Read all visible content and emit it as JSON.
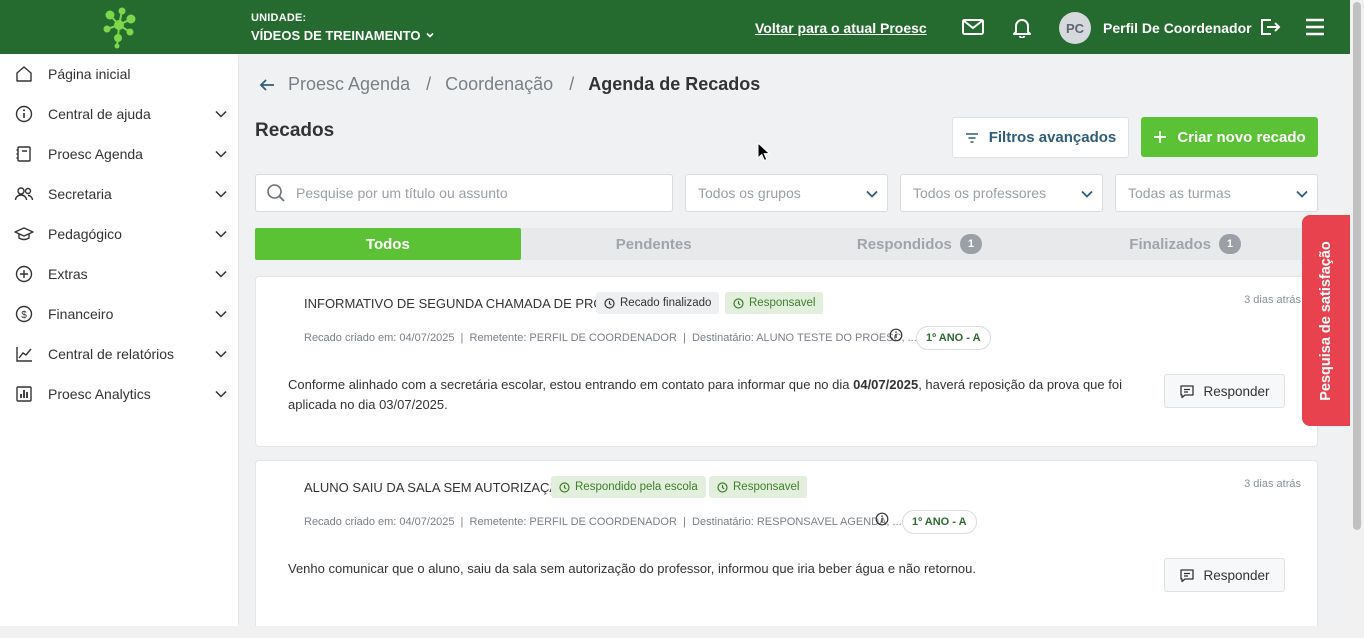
{
  "colors": {
    "brand_green": "#256a2f",
    "accent_green": "#5bc236",
    "survey_red": "#e8424f"
  },
  "header": {
    "unit_label": "UNIDADE:",
    "unit_value": "VÍDEOS DE TREINAMENTO",
    "back_link": "Voltar para o atual Proesc",
    "avatar_initials": "PC",
    "profile_name": "Perfil De Coordenador",
    "icons": [
      "logo-icon",
      "chevron-down-icon",
      "mail-icon",
      "bell-icon",
      "logout-icon",
      "menu-icon"
    ]
  },
  "sidebar": {
    "items": [
      {
        "label": "Página inicial",
        "icon": "home-icon"
      },
      {
        "label": "Central de ajuda",
        "icon": "info-icon"
      },
      {
        "label": "Proesc Agenda",
        "icon": "agenda-icon"
      },
      {
        "label": "Secretaria",
        "icon": "users-icon"
      },
      {
        "label": "Pedagógico",
        "icon": "graduation-cap-icon"
      },
      {
        "label": "Extras",
        "icon": "plus-circle-icon"
      },
      {
        "label": "Financeiro",
        "icon": "dollar-icon"
      },
      {
        "label": "Central de relatórios",
        "icon": "line-chart-icon"
      },
      {
        "label": "Proesc Analytics",
        "icon": "bar-chart-icon"
      }
    ]
  },
  "breadcrumb": {
    "item1": "Proesc Agenda",
    "sep1": "/",
    "item2": "Coordenação",
    "sep2": "/",
    "current": "Agenda de Recados"
  },
  "page": {
    "title": "Recados",
    "filter_button": "Filtros avançados",
    "create_button": "Criar novo recado"
  },
  "filters": {
    "search_placeholder": "Pesquise por um título ou assunto",
    "groups": "Todos os grupos",
    "teachers": "Todos os professores",
    "classes": "Todas as turmas"
  },
  "tabs": [
    {
      "label": "Todos",
      "count": ""
    },
    {
      "label": "Pendentes",
      "count": ""
    },
    {
      "label": "Respondidos",
      "count": "1"
    },
    {
      "label": "Finalizados",
      "count": "1"
    }
  ],
  "cards": [
    {
      "title": "INFORMATIVO DE SEGUNDA CHAMADA DE PROVA",
      "badge1": "Recado finalizado",
      "badge2": "Responsavel",
      "time": "3 dias atrás",
      "meta": "Recado criado em: 04/07/2025  |  Remetente: PERFIL DE COORDENADOR  |  Destinatário: ALUNO TESTE DO PROESC, ...",
      "class": "1º ANO - A",
      "body_pre": "Conforme alinhado com a secretária escolar, estou entrando em contato para informar que no dia ",
      "body_bold": "04/07/2025",
      "body_post": ", haverá reposição da prova que foi aplicada no dia 03/07/2025.",
      "reply": "Responder"
    },
    {
      "title": "ALUNO SAIU DA SALA SEM AUTORIZAÇÃO",
      "badge1": "Respondido pela escola",
      "badge2": "Responsavel",
      "time": "3 dias atrás",
      "meta": "Recado criado em: 04/07/2025  |  Remetente: PERFIL DE COORDENADOR  |  Destinatário: RESPONSAVEL AGENDA, ...",
      "class": "1º ANO - A",
      "body": "Venho comunicar que o aluno, saiu da sala sem autorização do professor, informou que iria beber água e não retornou.",
      "reply": "Responder"
    }
  ],
  "survey_tab": "Pesquisa de satisfação"
}
